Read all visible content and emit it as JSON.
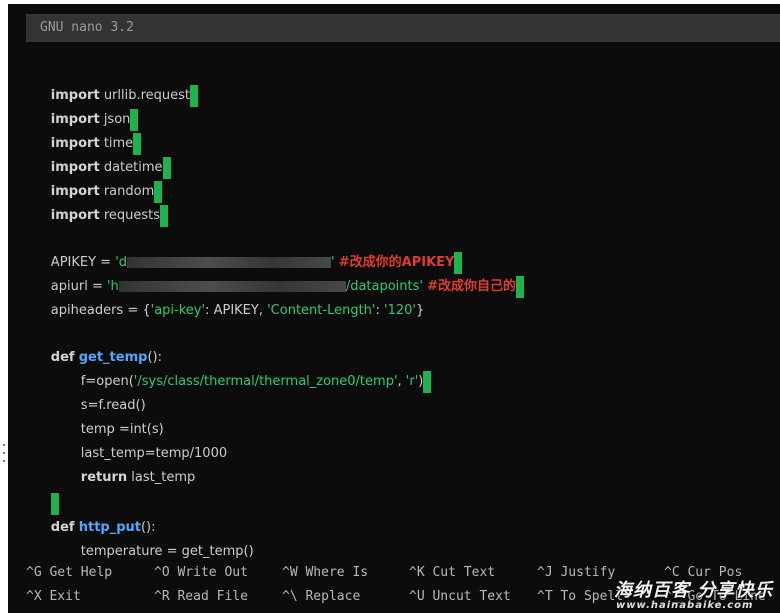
{
  "title": "GNU nano 3.2",
  "code": {
    "imports": [
      {
        "kw": "import",
        "mod": "urllib.request"
      },
      {
        "kw": "import",
        "mod": "json"
      },
      {
        "kw": "import",
        "mod": "time"
      },
      {
        "kw": "import",
        "mod": "datetime"
      },
      {
        "kw": "import",
        "mod": "random"
      },
      {
        "kw": "import",
        "mod": "requests"
      }
    ],
    "apikey": {
      "lhs": "APIKEY = ",
      "str_open": "'d",
      "str_close": "'",
      "comment": "#改成你的APIKEY"
    },
    "apiurl": {
      "lhs": "apiurl = ",
      "str_open": "'h",
      "str_tail": "/datapoints'",
      "comment": "#改成你自己的"
    },
    "apiheaders": {
      "lhs": "apiheaders = {",
      "k1": "'api-key'",
      "sep1": ": APIKEY, ",
      "k2": "'Content-Length'",
      "sep2": ": ",
      "v2": "'120'",
      "end": "}"
    },
    "get_temp": {
      "kw": "def",
      "name": "get_temp",
      "sig": "():",
      "open_pre": "f=open(",
      "path": "'/sys/class/thermal/thermal_zone0/temp'",
      "comma": ", ",
      "mode": "'r'",
      "close": ")",
      "read": "s=f.read()",
      "temp": "temp =int(s)",
      "last": "last_temp=temp/1000",
      "ret_kw": "return",
      "ret_val": " last_temp"
    },
    "http_put": {
      "kw": "def",
      "name": "http_put",
      "sig": "():",
      "body": "temperature = get_temp()"
    }
  },
  "shortcuts": [
    {
      "key": "^G",
      "label": "Get Help"
    },
    {
      "key": "^O",
      "label": "Write Out"
    },
    {
      "key": "^W",
      "label": "Where Is"
    },
    {
      "key": "^K",
      "label": "Cut Text"
    },
    {
      "key": "^J",
      "label": "Justify"
    },
    {
      "key": "^C",
      "label": "Cur Pos"
    },
    {
      "key": "^X",
      "label": "Exit"
    },
    {
      "key": "^R",
      "label": "Read File"
    },
    {
      "key": "^\\",
      "label": "Replace"
    },
    {
      "key": "^U",
      "label": "Uncut Text"
    },
    {
      "key": "^T",
      "label": "To Spell"
    },
    {
      "key": "^_",
      "label": "Go To Line"
    }
  ],
  "watermark": {
    "name": "海纳百客 分享快乐",
    "url": "www.hainabaike.com"
  },
  "colors": {
    "background": "#0c0c0c",
    "titlebar": "#333333",
    "cursor": "#1db34f",
    "string": "#2ecc71",
    "function": "#4fa8ff",
    "comment": "#e03c31"
  }
}
